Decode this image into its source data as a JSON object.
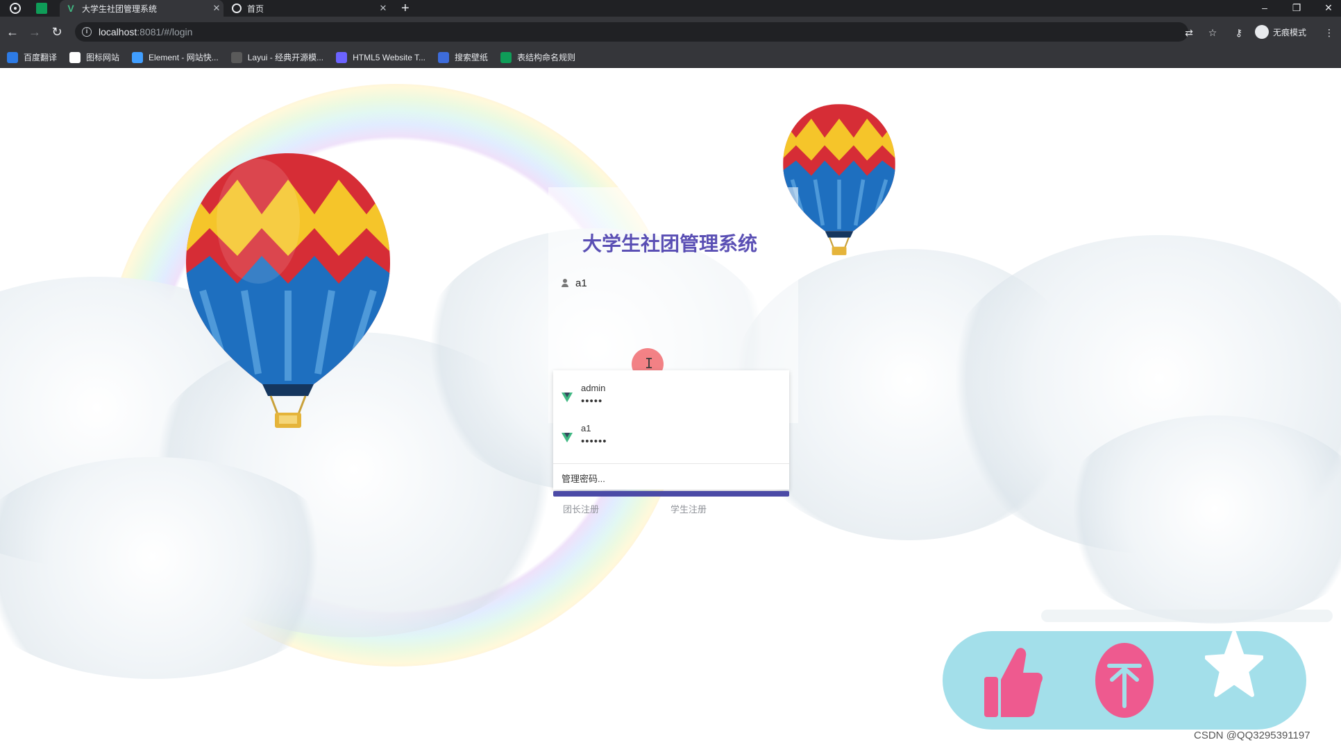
{
  "browser": {
    "tabs": [
      {
        "title": "大学生社团管理系统",
        "active": true,
        "icon": "vue-icon"
      },
      {
        "title": "首页",
        "active": false,
        "icon": "globe-icon"
      }
    ],
    "new_tab_glyph": "+",
    "window_controls": {
      "minimize": "–",
      "restore": "❐",
      "close": "✕"
    },
    "url_host": "localhost",
    "url_path": ":8081/#/login",
    "profile_label": "无痕模式",
    "bookmarks": [
      {
        "label": "百度翻译",
        "color": "#2d7be5"
      },
      {
        "label": "图标网站",
        "color": "#ffffff"
      },
      {
        "label": "Element - 网站快...",
        "color": "#409eff"
      },
      {
        "label": "Layui - 经典开源模...",
        "color": "#5a5a5a"
      },
      {
        "label": "HTML5 Website T...",
        "color": "#6c63ff"
      },
      {
        "label": "搜索壁纸",
        "color": "#3d6cdb"
      },
      {
        "label": "表结构命名规则",
        "color": "#0f9d58"
      }
    ]
  },
  "login": {
    "title": "大学生社团管理系统",
    "username_value": "a1",
    "autofill": [
      {
        "username": "admin",
        "password_mask": "•••••"
      },
      {
        "username": "a1",
        "password_mask": "••••••"
      }
    ],
    "manage_passwords": "管理密码...",
    "links": {
      "leader_register": "团长注册",
      "student_register": "学生注册"
    },
    "accent_color": "#4b4aa6",
    "title_color": "#5a4fb4"
  },
  "overlay": {
    "actions": [
      "thumbs-up-icon",
      "coin-icon",
      "star-icon"
    ],
    "pill_color": "#a3dfea",
    "icon_color": "#ee5a8f",
    "watermark": "CSDN @QQ3295391197"
  }
}
